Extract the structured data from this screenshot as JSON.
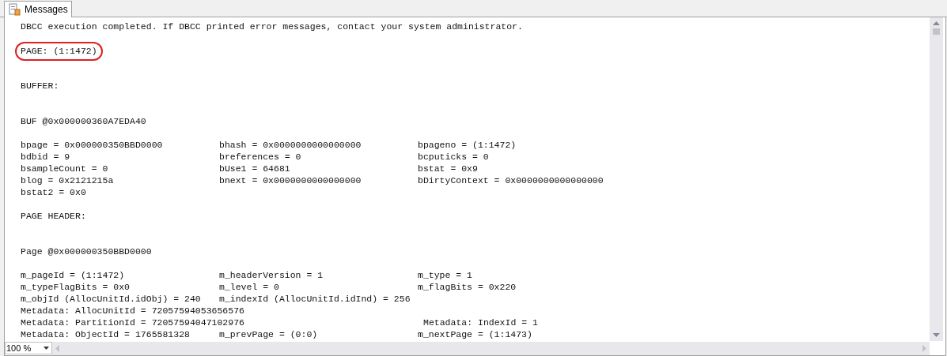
{
  "tabs": [
    {
      "label": "Messages",
      "selected": true
    }
  ],
  "lines": [
    {
      "kind": "text",
      "text": "DBCC execution completed. If DBCC printed error messages, contact your system administrator."
    },
    {
      "kind": "blank"
    },
    {
      "kind": "text",
      "text": "PAGE: (1:1472)",
      "highlighted": true
    },
    {
      "kind": "blank"
    },
    {
      "kind": "blank"
    },
    {
      "kind": "text",
      "text": "BUFFER:"
    },
    {
      "kind": "blank"
    },
    {
      "kind": "blank"
    },
    {
      "kind": "text",
      "text": "BUF @0x000000360A7EDA40"
    },
    {
      "kind": "blank"
    },
    {
      "kind": "fields",
      "cells": [
        "bpage = 0x000000350BBD0000",
        "bhash = 0x0000000000000000",
        "bpageno = (1:1472)"
      ]
    },
    {
      "kind": "fields",
      "cells": [
        "bdbid = 9",
        "breferences = 0",
        "bcputicks = 0"
      ]
    },
    {
      "kind": "fields",
      "cells": [
        "bsampleCount = 0",
        "bUse1 = 64681",
        "bstat = 0x9"
      ]
    },
    {
      "kind": "fields",
      "cells": [
        "blog = 0x2121215a",
        "bnext = 0x0000000000000000",
        "bDirtyContext = 0x0000000000000000"
      ]
    },
    {
      "kind": "fields",
      "cells": [
        "bstat2 = 0x0"
      ]
    },
    {
      "kind": "blank"
    },
    {
      "kind": "text",
      "text": "PAGE HEADER:"
    },
    {
      "kind": "blank"
    },
    {
      "kind": "blank"
    },
    {
      "kind": "text",
      "text": "Page @0x000000350BBD0000"
    },
    {
      "kind": "blank"
    },
    {
      "kind": "fields",
      "cells": [
        "m_pageId = (1:1472)",
        "m_headerVersion = 1",
        "m_type = 1"
      ]
    },
    {
      "kind": "fields",
      "cells": [
        "m_typeFlagBits = 0x0",
        "m_level = 0",
        "m_flagBits = 0x220"
      ]
    },
    {
      "kind": "fields",
      "cells": [
        "m_objId (AllocUnitId.idObj) = 240",
        "m_indexId (AllocUnitId.idInd) = 256"
      ]
    },
    {
      "kind": "fields",
      "cells": [
        "Metadata: AllocUnitId = 72057594053656576"
      ]
    },
    {
      "kind": "wide_first",
      "cells": [
        "Metadata: PartitionId = 72057594047102976",
        "Metadata: IndexId = 1"
      ]
    },
    {
      "kind": "fields",
      "cells": [
        "Metadata: ObjectId = 1765581328",
        "m_prevPage = (0:0)",
        "m_nextPage = (1:1473)"
      ]
    }
  ],
  "zoom": {
    "value": "100 %"
  }
}
